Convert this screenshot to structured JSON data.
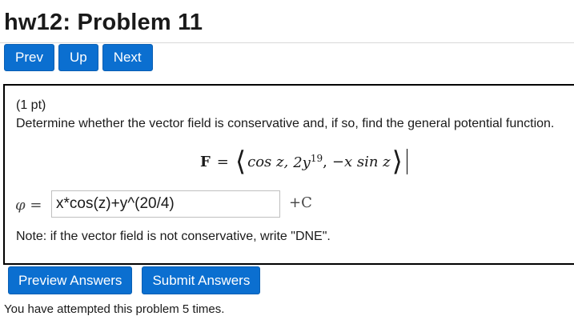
{
  "page": {
    "title": "hw12: Problem 11"
  },
  "nav": {
    "prev": "Prev",
    "up": "Up",
    "next": "Next"
  },
  "problem": {
    "points": "(1 pt)",
    "question": "Determine whether the vector field is conservative and, if so, find the general potential function.",
    "formula": {
      "lhs": "F",
      "equals": "=",
      "left_angle": "⟨",
      "comp1": "cos z,",
      "comp2_base": "2y",
      "comp2_exp": "19",
      "comp2_sep": ",",
      "comp3": "−x sin z",
      "right_angle": "⟩"
    },
    "phi_label": "φ =",
    "answer_value": "x*cos(z)+y^(20/4)",
    "constant": "+C",
    "note": "Note: if the vector field is not conservative, write \"DNE\"."
  },
  "actions": {
    "preview": "Preview Answers",
    "submit": "Submit Answers"
  },
  "footer": {
    "attempts": "You have attempted this problem 5 times."
  },
  "colors": {
    "button": "#0b6fd0",
    "text": "#1a1a1a",
    "border": "#000000"
  }
}
